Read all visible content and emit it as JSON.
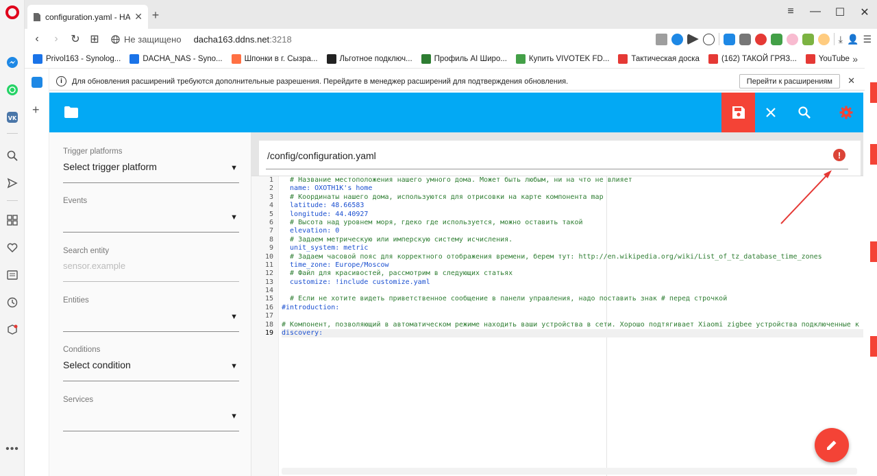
{
  "browser": {
    "tab": {
      "title": "configuration.yaml - HASS"
    },
    "address": {
      "security_label": "Не защищено",
      "host": "dacha163.ddns.net",
      "port": ":3218"
    },
    "bookmarks": [
      {
        "label": "Privol163 - Synolog...",
        "color": "#1a73e8"
      },
      {
        "label": "DACHA_NAS - Syno...",
        "color": "#1a73e8"
      },
      {
        "label": "Шпонки в г. Сызра...",
        "color": "#ff7043"
      },
      {
        "label": "Льготное подключ...",
        "color": "#222222"
      },
      {
        "label": "Профиль AI Широ...",
        "color": "#2e7d32"
      },
      {
        "label": "Купить VIVOTEK FD...",
        "color": "#43a047"
      },
      {
        "label": "Тактическая доска",
        "color": "#e53935"
      },
      {
        "label": "(162) ТАКОЙ ГРЯЗ...",
        "color": "#e53935"
      },
      {
        "label": "YouTube",
        "color": "#e53935"
      }
    ],
    "infobar": {
      "message": "Для обновления расширений требуются дополнительные разрешения. Перейдите в менеджер расширений для подтверждения обновления.",
      "button": "Перейти к расширениям"
    }
  },
  "colors": {
    "primary": "#03a9f4",
    "accent": "#f44336"
  },
  "sidepanel": {
    "trigger": {
      "label": "Trigger platforms",
      "value": "Select trigger platform"
    },
    "events": {
      "label": "Events",
      "value": ""
    },
    "search": {
      "label": "Search entity",
      "placeholder": "sensor.example"
    },
    "entities": {
      "label": "Entities",
      "value": ""
    },
    "conditions": {
      "label": "Conditions",
      "value": "Select condition"
    },
    "services": {
      "label": "Services",
      "value": ""
    }
  },
  "editor": {
    "path": "/config/configuration.yaml",
    "lines": [
      {
        "n": "1",
        "text": "  # Название местоположения нашего умного дома. Может быть любым, ни на что не влияет",
        "kind": "com"
      },
      {
        "n": "2",
        "text": "  name: ОХОТН1К's home",
        "kind": "kv"
      },
      {
        "n": "3",
        "text": "  # Координаты нашего дома, используются для отрисовки на карте компонента map",
        "kind": "com"
      },
      {
        "n": "4",
        "text": "  latitude: 48.66583",
        "kind": "kv"
      },
      {
        "n": "5",
        "text": "  longitude: 44.40927",
        "kind": "kv"
      },
      {
        "n": "6",
        "text": "  # Высота над уровнем моря, гдеко где используется, можно оставить такой",
        "kind": "com"
      },
      {
        "n": "7",
        "text": "  elevation: 0",
        "kind": "kv"
      },
      {
        "n": "8",
        "text": "  # Задаем метрическую или имперскую систему исчисления.",
        "kind": "com"
      },
      {
        "n": "9",
        "text": "  unit_system: metric",
        "kind": "kv"
      },
      {
        "n": "10",
        "text": "  # Задаем часовой пояс для корректного отображения времени, берем тут: http://en.wikipedia.org/wiki/List_of_tz_database_time_zones",
        "kind": "com"
      },
      {
        "n": "11",
        "text": "  time_zone: Europe/Moscow",
        "kind": "kv"
      },
      {
        "n": "12",
        "text": "  # Файл для красивостей, рассмотрим в следующих статьях",
        "kind": "com"
      },
      {
        "n": "13",
        "text": "  customize: !include customize.yaml",
        "kind": "kv"
      },
      {
        "n": "14",
        "text": "  ",
        "kind": "com"
      },
      {
        "n": "15",
        "text": "  # Если не хотите видеть приветственное сообщение в панели управления, надо поставить знак # перед строчкой",
        "kind": "com"
      },
      {
        "n": "16",
        "text": "#introduction:",
        "kind": "kv"
      },
      {
        "n": "17",
        "text": "  ",
        "kind": "com"
      },
      {
        "n": "18",
        "text": "# Компонент, позволяющий в автоматическом режиме находить ваши устройства в сети. Хорошо подтягивает Xiaomi zigbee устройства подключенные к шлюзу",
        "kind": "com"
      },
      {
        "n": "19",
        "text": "discovery:",
        "kind": "kv"
      }
    ],
    "active_line": "19"
  }
}
